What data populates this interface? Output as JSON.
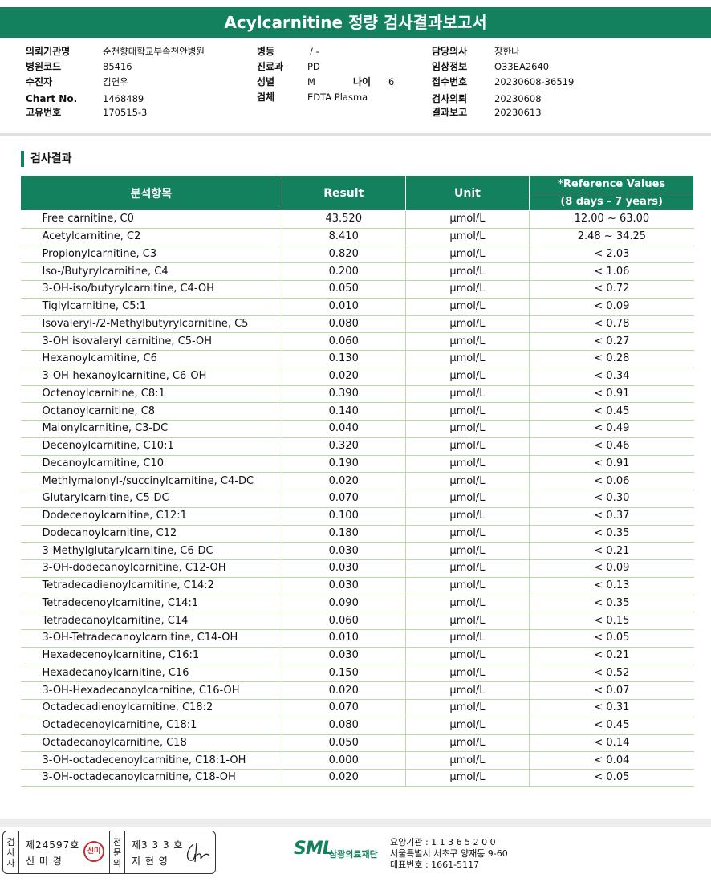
{
  "report": {
    "title": "Acylcarnitine 정량 검사결과보고서"
  },
  "patient_info": {
    "col1": [
      {
        "label": "의뢰기관명",
        "value": "순천향대학교부속천안병원"
      },
      {
        "label": "병원코드",
        "value": "85416"
      },
      {
        "label": "수진자",
        "value": "김연우"
      },
      {
        "label": "Chart No.",
        "value": "1468489"
      },
      {
        "label": "고유번호",
        "value": "170515-3"
      }
    ],
    "col2": [
      {
        "label": "병동",
        "value": "/ -"
      },
      {
        "label": "진료과",
        "value": "PD"
      },
      {
        "label": "성별",
        "value": "M"
      },
      {
        "label": "검체",
        "value": "EDTA Plasma"
      }
    ],
    "age": {
      "label": "나이",
      "value": "6"
    },
    "col3": [
      {
        "label": "담당의사",
        "value": "장한나"
      },
      {
        "label": "임상정보",
        "value": "O33EA2640"
      },
      {
        "label": "접수번호",
        "value": "20230608-36519"
      },
      {
        "label": "검사의뢰",
        "value": "20230608"
      },
      {
        "label": "결과보고",
        "value": "20230613"
      }
    ]
  },
  "section": {
    "title": "검사결과"
  },
  "table": {
    "headers": {
      "item": "분석항목",
      "result": "Result",
      "unit": "Unit",
      "ref_top": "*Reference Values",
      "ref_bottom": "(8 days - 7 years)"
    },
    "rows": [
      {
        "name": "Free carnitine, C0",
        "result": "43.520",
        "unit": "μmol/L",
        "ref": "12.00 ~ 63.00"
      },
      {
        "name": "Acetylcarnitine, C2",
        "result": "8.410",
        "unit": "μmol/L",
        "ref": "2.48 ~ 34.25"
      },
      {
        "name": "Propionylcarnitine, C3",
        "result": "0.820",
        "unit": "μmol/L",
        "ref": "< 2.03"
      },
      {
        "name": "Iso-/Butyrylcarnitine, C4",
        "result": "0.200",
        "unit": "μmol/L",
        "ref": "< 1.06"
      },
      {
        "name": "3-OH-iso/butyrylcarnitine, C4-OH",
        "result": "0.050",
        "unit": "μmol/L",
        "ref": "< 0.72"
      },
      {
        "name": "Tiglylcarnitine, C5:1",
        "result": "0.010",
        "unit": "μmol/L",
        "ref": "< 0.09"
      },
      {
        "name": "Isovaleryl-/2-Methylbutyrylcarnitine, C5",
        "result": "0.080",
        "unit": "μmol/L",
        "ref": "< 0.78"
      },
      {
        "name": "3-OH isovaleryl carnitine, C5-OH",
        "result": "0.060",
        "unit": "μmol/L",
        "ref": "< 0.27"
      },
      {
        "name": "Hexanoylcarnitine, C6",
        "result": "0.130",
        "unit": "μmol/L",
        "ref": "< 0.28"
      },
      {
        "name": "3-OH-hexanoylcarnitine, C6-OH",
        "result": "0.020",
        "unit": "μmol/L",
        "ref": "< 0.34"
      },
      {
        "name": "Octenoylcarnitine, C8:1",
        "result": "0.390",
        "unit": "μmol/L",
        "ref": "< 0.91"
      },
      {
        "name": "Octanoylcarnitine, C8",
        "result": "0.140",
        "unit": "μmol/L",
        "ref": "< 0.45"
      },
      {
        "name": "Malonylcarnitine, C3-DC",
        "result": "0.040",
        "unit": "μmol/L",
        "ref": "< 0.49"
      },
      {
        "name": "Decenoylcarnitine, C10:1",
        "result": "0.320",
        "unit": "μmol/L",
        "ref": "< 0.46"
      },
      {
        "name": "Decanoylcarnitine, C10",
        "result": "0.190",
        "unit": "μmol/L",
        "ref": "< 0.91"
      },
      {
        "name": "Methlymalonyl-/succinylcarnitine, C4-DC",
        "result": "0.020",
        "unit": "μmol/L",
        "ref": "< 0.06"
      },
      {
        "name": "Glutarylcarnitine, C5-DC",
        "result": "0.070",
        "unit": "μmol/L",
        "ref": "< 0.30"
      },
      {
        "name": "Dodecenoylcarnitine, C12:1",
        "result": "0.100",
        "unit": "μmol/L",
        "ref": "< 0.37"
      },
      {
        "name": "Dodecanoylcarnitine, C12",
        "result": "0.180",
        "unit": "μmol/L",
        "ref": "< 0.35"
      },
      {
        "name": "3-Methylglutarylcarnitine, C6-DC",
        "result": "0.030",
        "unit": "μmol/L",
        "ref": "< 0.21"
      },
      {
        "name": "3-OH-dodecanoylcarnitine, C12-OH",
        "result": "0.030",
        "unit": "μmol/L",
        "ref": "< 0.09"
      },
      {
        "name": "Tetradecadienoylcarnitine, C14:2",
        "result": "0.030",
        "unit": "μmol/L",
        "ref": "< 0.13"
      },
      {
        "name": "Tetradecenoylcarnitine, C14:1",
        "result": "0.090",
        "unit": "μmol/L",
        "ref": "< 0.35"
      },
      {
        "name": "Tetradecanoylcarnitine, C14",
        "result": "0.060",
        "unit": "μmol/L",
        "ref": "< 0.15"
      },
      {
        "name": "3-OH-Tetradecanoylcarnitine, C14-OH",
        "result": "0.010",
        "unit": "μmol/L",
        "ref": "< 0.05"
      },
      {
        "name": "Hexadecenoylcarnitine, C16:1",
        "result": "0.030",
        "unit": "μmol/L",
        "ref": "< 0.21"
      },
      {
        "name": "Hexadecanoylcarnitine, C16",
        "result": "0.150",
        "unit": "μmol/L",
        "ref": "< 0.52"
      },
      {
        "name": "3-OH-Hexadecanoylcarnitine, C16-OH",
        "result": "0.020",
        "unit": "μmol/L",
        "ref": "< 0.07"
      },
      {
        "name": "Octadecadienoylcarnitine, C18:2",
        "result": "0.070",
        "unit": "μmol/L",
        "ref": "< 0.31"
      },
      {
        "name": "Octadecenoylcarnitine, C18:1",
        "result": "0.080",
        "unit": "μmol/L",
        "ref": "< 0.45"
      },
      {
        "name": "Octadecanoylcarnitine, C18",
        "result": "0.050",
        "unit": "μmol/L",
        "ref": "< 0.14"
      },
      {
        "name": "3-OH-octadecenoylcarnitine, C18:1-OH",
        "result": "0.000",
        "unit": "μmol/L",
        "ref": "< 0.04"
      },
      {
        "name": "3-OH-octadecanoylcarnitine, C18-OH",
        "result": "0.020",
        "unit": "μmol/L",
        "ref": "< 0.05"
      }
    ]
  },
  "footer": {
    "tester": {
      "vertical": "검사자",
      "license": "제24597호",
      "name": "신 미 경",
      "seal_text": "신미"
    },
    "specialist": {
      "vertical": "전문의",
      "license": "제3 3 3 호",
      "name": "지 현 영"
    },
    "logo": {
      "mark": "SML",
      "name": "삼광의료재단"
    },
    "org_lines": [
      "요양기관 : 1 1 3 6 5 2 0 0",
      "서울특별시 서초구 양재동 9-60",
      "대표번호 : 1661-5117"
    ]
  },
  "colors": {
    "header_green": "#13805e",
    "row_border": "#b7dba0"
  }
}
